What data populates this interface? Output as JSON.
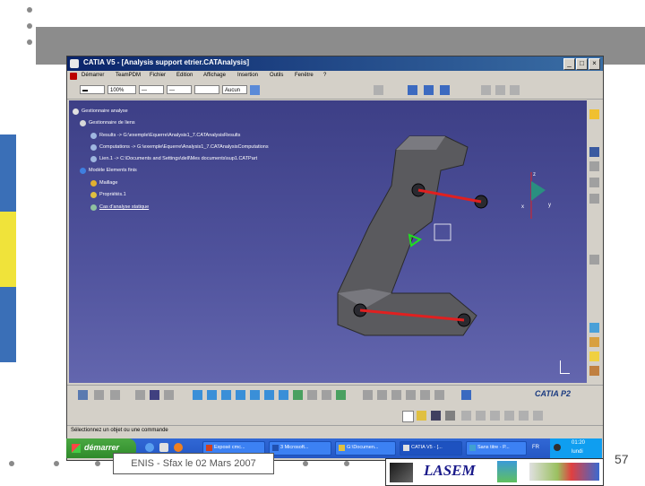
{
  "window": {
    "title": "CATIA V5 - [Analysis support etrier.CATAnalysis]"
  },
  "menu": [
    "Démarrer",
    "TeamPDM",
    "Fichier",
    "Edition",
    "Affichage",
    "Insertion",
    "Outils",
    "Fenêtre",
    "?"
  ],
  "toolbar": {
    "zoom_value": "100%",
    "style_value": "Aucun"
  },
  "tree": {
    "root": "Gestionnaire analyse",
    "links_manager": "Gestionnaire de liens",
    "results": "Results -> G:\\exemple\\Equerre\\Analysis1_7.CATAnalysisResults",
    "computations": "Computations -> G:\\exemple\\Equerre\\Analysis1_7.CATAnalysisComputations",
    "link": "Lien.1 -> C:\\Documents and Settings\\dell\\Mes documents\\sup1.CATPart",
    "fem_model": "Modèle Elements finis",
    "mesh": "Maillage",
    "properties": "Propriétés.1",
    "static_case": "Cas d'analyse statique"
  },
  "compass": {
    "x": "x",
    "y": "y",
    "z": "z"
  },
  "status": "Sélectionnez un objet ou une commande",
  "brand": "CATIA P2",
  "taskbar": {
    "start": "démarrer",
    "items": [
      "Exposé cmc...",
      "3 Microsoft...",
      "G:\\Documen...",
      "CATIA V5 - [...",
      "Sans titre - P..."
    ],
    "lang": "FR",
    "clock": "01:20",
    "day": "lundi"
  },
  "footer": {
    "text": "ENIS - Sfax le 02 Mars 2007",
    "page": "57",
    "logo_text": "LASEM"
  },
  "colors": {
    "viewport_top": "#3d3f86",
    "title_blue": "#0a246a",
    "taskbar_blue": "#2457c4",
    "start_green": "#3a9a34",
    "accent_blue": "#3a6fb7",
    "accent_yellow": "#f0e33a"
  }
}
